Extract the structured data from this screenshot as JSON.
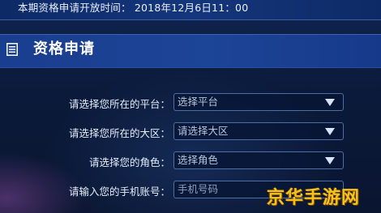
{
  "banner": {
    "text": "本期资格申请开放时间：  2018年12月6日11：00"
  },
  "section": {
    "title": "资格申请",
    "icon": "document-list-icon"
  },
  "form": {
    "platform": {
      "label": "请选择您所在的平台：",
      "value": "选择平台"
    },
    "region": {
      "label": "请选择您所在的大区：",
      "value": "请选择大区"
    },
    "role": {
      "label": "请选择您的角色：",
      "value": "选择角色"
    },
    "phone": {
      "label": "请输入您的手机账号：",
      "placeholder": "手机号码"
    }
  },
  "watermark": {
    "text": "京华手游网"
  },
  "colors": {
    "background": "#0c1b3e",
    "title_bar": "#1c4497",
    "field_border": "#4e6fa6",
    "watermark": "#f6c21b"
  }
}
